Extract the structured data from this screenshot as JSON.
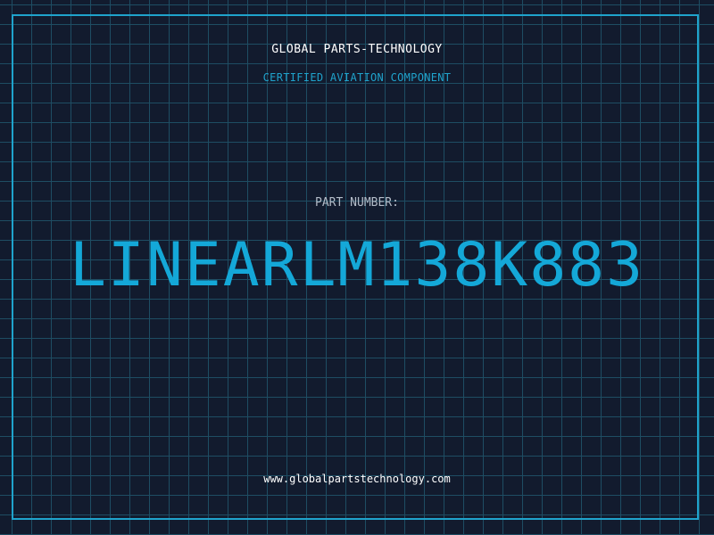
{
  "header": {
    "company": "GLOBAL PARTS-TECHNOLOGY",
    "subtitle": "CERTIFIED AVIATION COMPONENT"
  },
  "part": {
    "label": "PART NUMBER:",
    "number": "LINEARLM138K883"
  },
  "footer": {
    "website": "www.globalpartstechnology.com"
  },
  "colors": {
    "background": "#121b2e",
    "grid": "#1e4d63",
    "accent": "#1fa3cc",
    "part_number": "#14a8d8",
    "label": "#b3bcc8",
    "text": "#ffffff"
  }
}
